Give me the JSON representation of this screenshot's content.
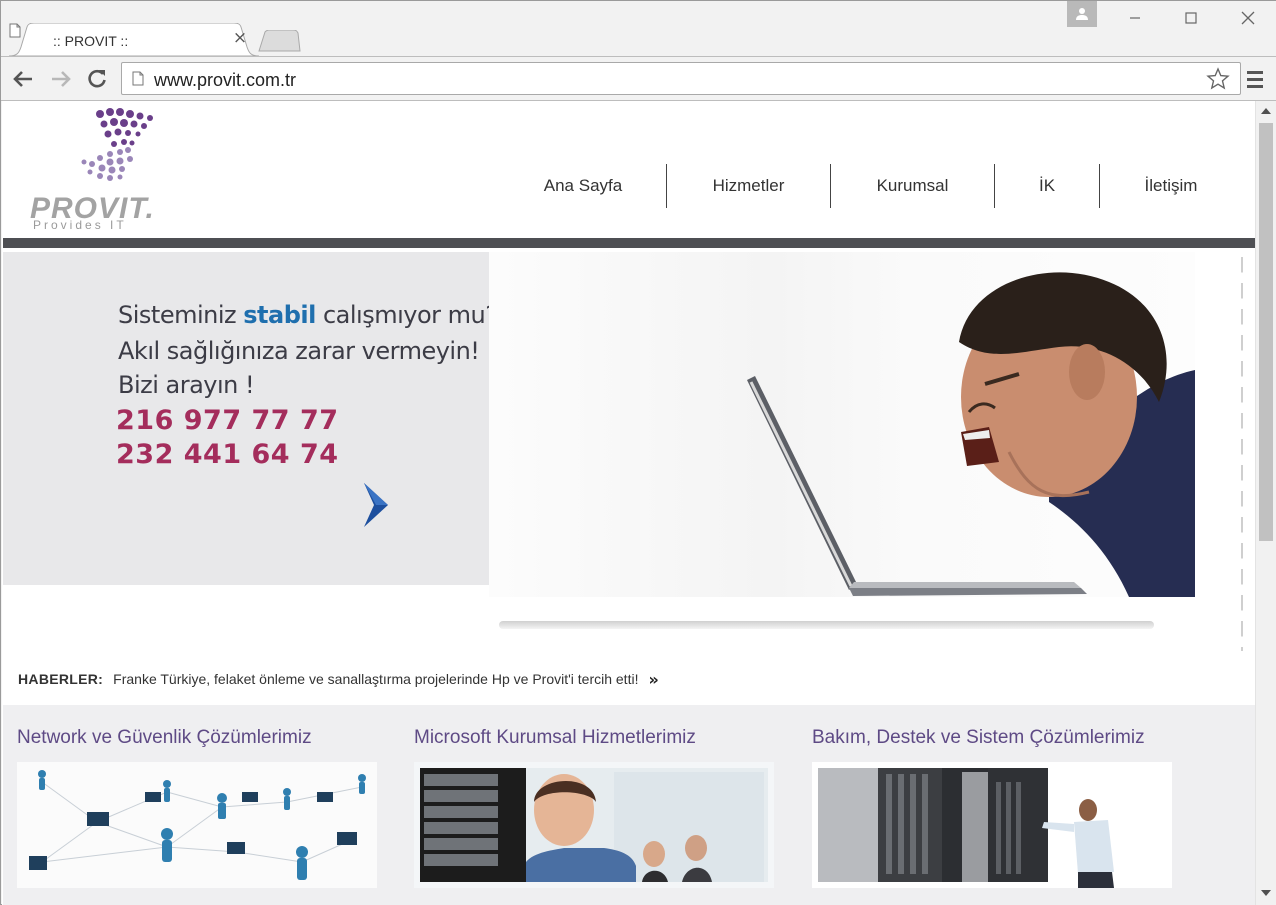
{
  "browser": {
    "tab_title": ":: PROVIT ::",
    "url": "www.provit.com.tr"
  },
  "site": {
    "logo_text": "PROVIT.",
    "logo_tagline": "Provides IT",
    "nav": [
      "Ana Sayfa",
      "Hizmetler",
      "Kurumsal",
      "İK",
      "İletişim"
    ]
  },
  "hero": {
    "line1_before": "Sisteminiz ",
    "line1_highlight": "stabil",
    "line1_after": " calışmıyor mu?",
    "line2": "Akıl sağlığınıza zarar vermeyin!",
    "line3": "Bizi arayın !",
    "phone1": "216 977 77 77",
    "phone2": "232 441 64 74"
  },
  "news": {
    "label": "HABERLER:",
    "text": "Franke Türkiye, felaket önleme ve sanallaştırma projelerinde Hp ve Provit'i tercih etti!"
  },
  "services": [
    {
      "title": "Network ve Güvenlik Çözümlerimiz"
    },
    {
      "title": "Microsoft Kurumsal Hizmetlerimiz"
    },
    {
      "title": "Bakım, Destek ve Sistem Çözümlerimiz"
    }
  ],
  "colors": {
    "accent_blue": "#1f6fae",
    "phone_magenta": "#a42d5c",
    "service_title_purple": "#5e4a85",
    "header_bar": "#4e4f53"
  }
}
